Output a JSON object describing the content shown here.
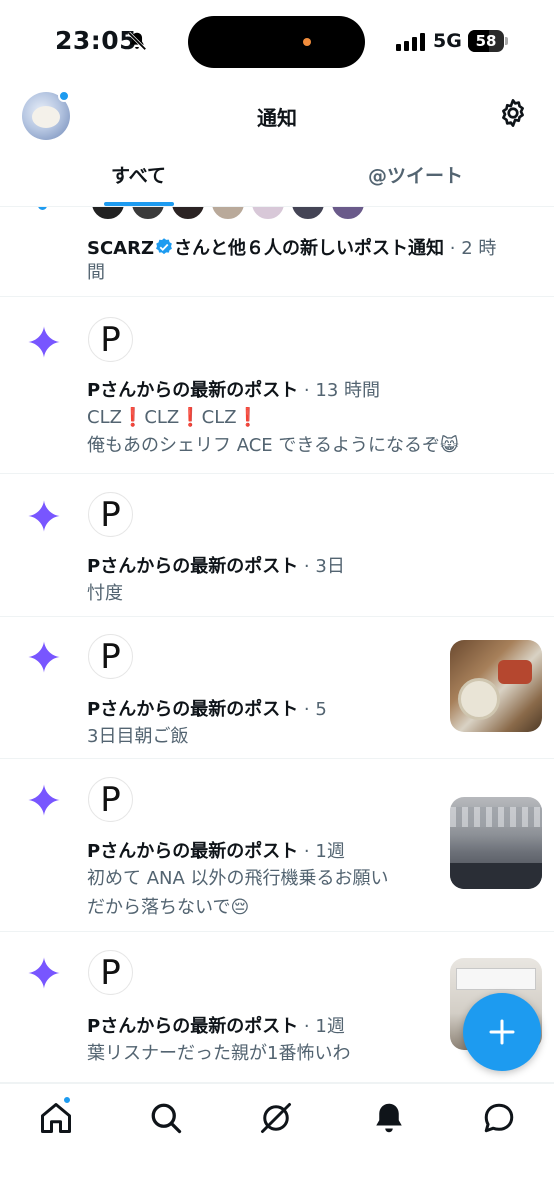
{
  "status_bar": {
    "time": "23:05",
    "network": "5G",
    "battery": "58",
    "battery_level_percent": 58
  },
  "header": {
    "title": "通知"
  },
  "tabs": [
    {
      "label": "すべて",
      "active": true
    },
    {
      "label": "@ツイート",
      "active": false
    }
  ],
  "notifications": [
    {
      "name": "SCARZ",
      "rest": "さんと他６人の新しいポスト通知",
      "meta": " · 2 時",
      "line2": "間"
    },
    {
      "avatar_letter": "P",
      "title": "Pさんからの最新のポスト",
      "meta": " · 13 時間",
      "body": [
        "CLZ❗️CLZ❗️CLZ❗️",
        "俺もあのシェリフ ACE できるようになるぞ😸"
      ]
    },
    {
      "avatar_letter": "P",
      "title": "Pさんからの最新のポスト",
      "meta": " · 3日",
      "body": [
        "忖度"
      ]
    },
    {
      "avatar_letter": "P",
      "title": "Pさんからの最新のポスト",
      "meta": " · 5",
      "body": [
        "3日目朝ご飯"
      ]
    },
    {
      "avatar_letter": "P",
      "title": "Pさんからの最新のポスト",
      "meta": " · 1週",
      "body": [
        "初めて ANA 以外の飛行機乗るお願い",
        "だから落ちないで😔"
      ]
    },
    {
      "avatar_letter": "P",
      "title": "Pさんからの最新のポスト",
      "meta": " · 1週",
      "body": [
        "葉リスナーだった親が1番怖いわ"
      ]
    }
  ],
  "colors": {
    "accent": "#1d9bf0",
    "star": "#7856ff",
    "secondary_text": "#536471"
  },
  "icons": {
    "settings": "gear-icon",
    "compose": "plus-icon",
    "nav": [
      "home-icon",
      "search-icon",
      "grok-icon",
      "bell-icon",
      "messages-icon"
    ]
  }
}
